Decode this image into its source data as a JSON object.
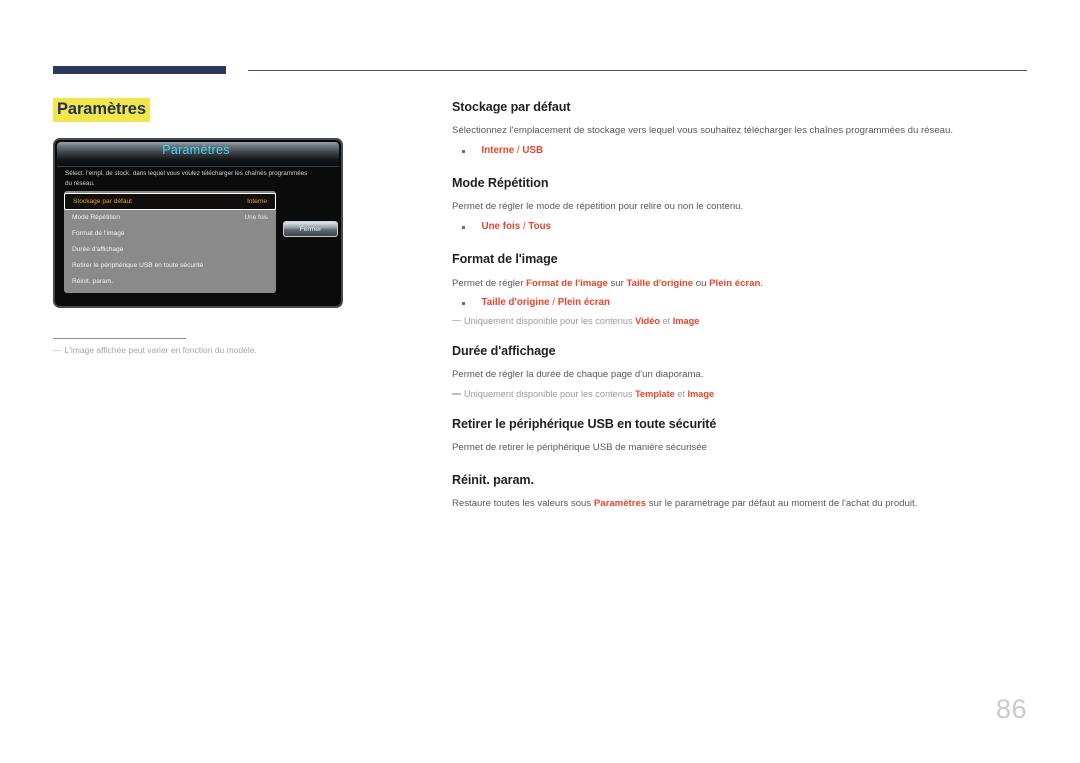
{
  "page": {
    "number": "86",
    "title": "Paramètres"
  },
  "tv_mock": {
    "header_title": "Paramètres",
    "description": "Sélect. l'empl. de stock. dans lequel vous voulez télécharger les chaînes programmées du réseau.",
    "close_button": "Fermer",
    "menu_items": [
      {
        "label": "Stockage par défaut",
        "value": "Interne",
        "selected": true
      },
      {
        "label": "Mode Répétition",
        "value": "Une fois",
        "selected": false
      },
      {
        "label": "Format de l'image",
        "value": "",
        "selected": false
      },
      {
        "label": "Durée d'affichage",
        "value": "",
        "selected": false
      },
      {
        "label": "Retirer le périphérique USB en toute sécurité",
        "value": "",
        "selected": false
      },
      {
        "label": "Réinit. param.",
        "value": "",
        "selected": false
      }
    ]
  },
  "left_note": {
    "dash": "―",
    "text": "L'image affichée peut varier en fonction du modèle."
  },
  "sections": {
    "stockage": {
      "title": "Stockage par défaut",
      "body": "Sélectionnez l'emplacement de stockage vers lequel vous souhaitez télécharger les chaînes programmées du réseau.",
      "option_a": "Interne",
      "option_sep": " / ",
      "option_b": "USB"
    },
    "repetition": {
      "title": "Mode Répétition",
      "body": "Permet de régler le mode de répétition pour relire ou non le contenu.",
      "option_a": "Une fois",
      "option_sep": " / ",
      "option_b": "Tous"
    },
    "format": {
      "title": "Format de l'image",
      "body_1": "Permet de régler ",
      "body_hl_1": "Format de l'image",
      "body_2": " sur ",
      "body_hl_2": "Taille d'origine",
      "body_3": " ou ",
      "body_hl_3": "Plein écran",
      "body_4": ".",
      "option_a": "Taille d'origine",
      "option_sep": " / ",
      "option_b": "Plein écran",
      "note_1": "Uniquement disponible pour les contenus ",
      "note_hl_1": "Vidéo",
      "note_2": " et ",
      "note_hl_2": "Image"
    },
    "duree": {
      "title": "Durée d'affichage",
      "body": "Permet de régler la durée de chaque page d'un diaporama.",
      "note_1": "Uniquement disponible pour les contenus ",
      "note_hl_1": "Template",
      "note_2": " et ",
      "note_hl_2": "Image"
    },
    "usb": {
      "title": "Retirer le périphérique USB en toute sécurité",
      "body": "Permet de retirer le périphérique USB de manière sécurisée"
    },
    "reinit": {
      "title": "Réinit. param.",
      "body_1": "Restaure toutes les valeurs sous ",
      "body_hl_1": "Paramètres",
      "body_2": " sur le paramétrage par défaut au moment de l'achat du produit."
    }
  },
  "colors": {
    "accent_red": "#e8442a",
    "title_navy": "#233158",
    "highlight_yellow": "#f2e64b",
    "tv_cyan": "#3fd8f0",
    "tv_selected_amber": "#f0a81e"
  }
}
